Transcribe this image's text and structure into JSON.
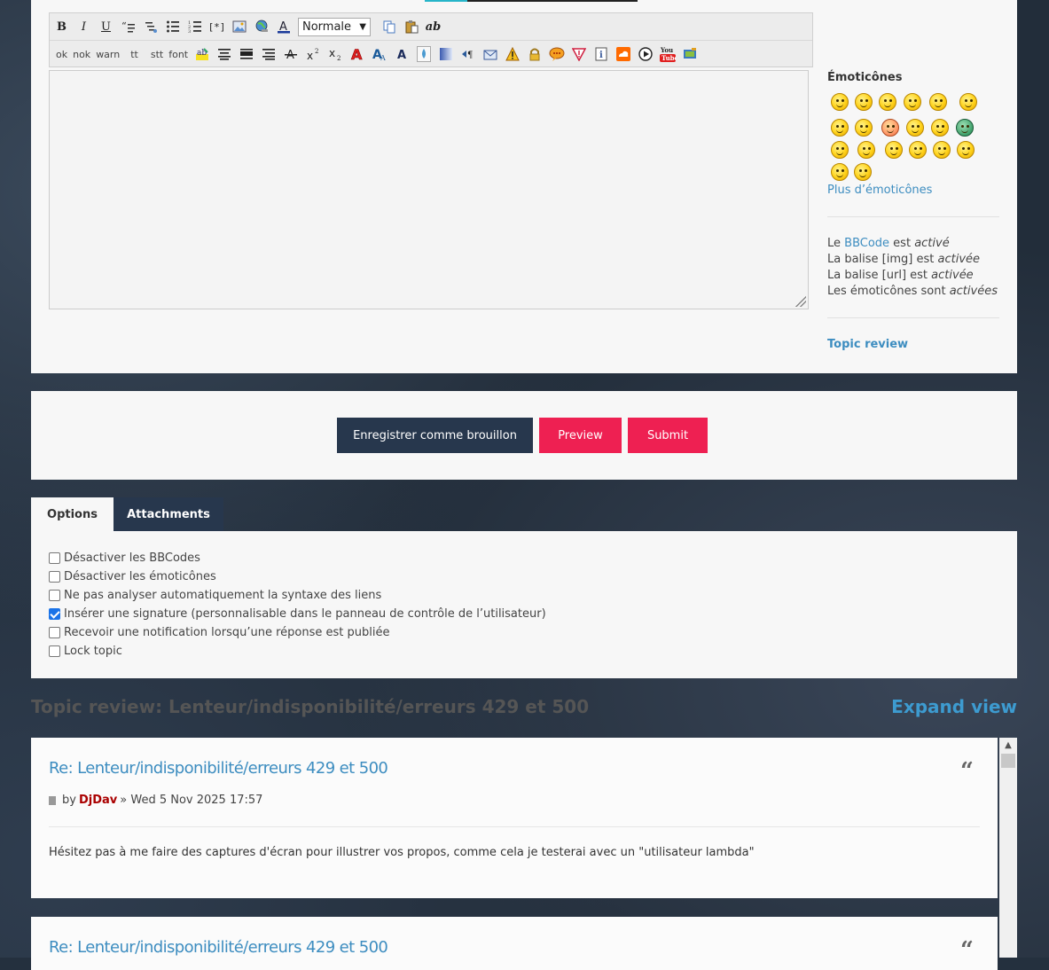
{
  "toolbar": {
    "row1": [
      "B",
      "I",
      "U",
      "quote",
      "code",
      "list",
      "list-ordered",
      "[*]",
      "img",
      "url",
      "color"
    ],
    "font_size_select": "Normale",
    "row1_extra": [
      "copy",
      "paste",
      "ab"
    ],
    "row2_text": [
      "ok",
      "nok",
      "warn",
      "tt",
      "stt",
      "font"
    ]
  },
  "sidebar": {
    "emoticons_title": "Émoticônes",
    "more_emoticons": "Plus d’émoticônes",
    "status": {
      "bbcode_prefix": "Le ",
      "bbcode_link": "BBCode",
      "bbcode_mid": " est ",
      "bbcode_state": "activé",
      "img_prefix": "La balise [img] est ",
      "img_state": "activée",
      "url_prefix": "La balise [url] est ",
      "url_state": "activée",
      "smilies_prefix": "Les émoticônes sont ",
      "smilies_state": "activées"
    },
    "topic_review_link": "Topic review"
  },
  "actions": {
    "draft": "Enregistrer comme brouillon",
    "preview": "Preview",
    "submit": "Submit"
  },
  "tabs": {
    "options": "Options",
    "attachments": "Attachments"
  },
  "options": [
    {
      "label": "Désactiver les BBCodes",
      "checked": false
    },
    {
      "label": "Désactiver les émoticônes",
      "checked": false
    },
    {
      "label": "Ne pas analyser automatiquement la syntaxe des liens",
      "checked": false
    },
    {
      "label": "Insérer une signature (personnalisable dans le panneau de contrôle de l’utilisateur)",
      "checked": true
    },
    {
      "label": "Recevoir une notification lorsqu’une réponse est publiée",
      "checked": false
    },
    {
      "label": "Lock topic",
      "checked": false
    }
  ],
  "topic_review": {
    "title": "Topic review: Lenteur/indisponibilité/erreurs 429 et 500",
    "expand": "Expand view"
  },
  "posts": [
    {
      "title": "Re: Lenteur/indisponibilité/erreurs 429 et 500",
      "by": "by",
      "author": "DjDav",
      "sep": "»",
      "date": "Wed 5 Nov 2025 17:57",
      "body": "Hésitez pas à me faire des captures d'écran pour illustrer vos propos, comme cela je testerai avec un \"utilisateur lambda\""
    },
    {
      "title": "Re: Lenteur/indisponibilité/erreurs 429 et 500"
    }
  ],
  "colors": {
    "accent_blue": "#3d8dc0",
    "button_dark": "#27374d",
    "button_red": "#ee2052",
    "author_red": "#aa0000"
  }
}
